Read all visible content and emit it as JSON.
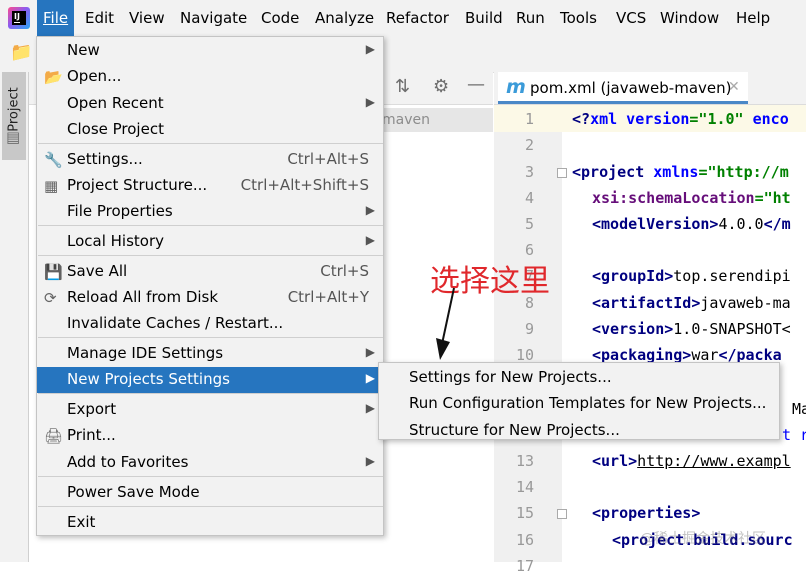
{
  "menubar": {
    "items": [
      {
        "label": "File"
      },
      {
        "label": "Edit"
      },
      {
        "label": "View"
      },
      {
        "label": "Navigate"
      },
      {
        "label": "Code"
      },
      {
        "label": "Analyze"
      },
      {
        "label": "Refactor"
      },
      {
        "label": "Build"
      },
      {
        "label": "Run"
      },
      {
        "label": "Tools"
      },
      {
        "label": "VCS"
      },
      {
        "label": "Window"
      },
      {
        "label": "Help"
      }
    ],
    "active_item": "File"
  },
  "project_panel": {
    "tab_label": "Project",
    "selected_row_text": "maven"
  },
  "editor": {
    "tab_title": "pom.xml (javaweb-maven)",
    "line_numbers": [
      "1",
      "2",
      "3",
      "4",
      "5",
      "6",
      "7",
      "8",
      "9",
      "10",
      "13",
      "14",
      "15",
      "16",
      "17"
    ],
    "lines": {
      "l1": {
        "p1": "<?",
        "p2": "xml version",
        "p3": "=\"1.0\"",
        "p4": " enco"
      },
      "l3": {
        "p1": "<project ",
        "p2": "xmlns",
        "p3": "=\"http://m"
      },
      "l4": {
        "p1": "xsi:schemaLocation",
        "p2": "=\"ht"
      },
      "l5": {
        "p1": "<modelVersion>",
        "p2": "4.0.0",
        "p3": "</m"
      },
      "l7": {
        "p1": "<groupId>",
        "p2": "top.serendipi"
      },
      "l8": {
        "p1": "<artifactId>",
        "p2": "javaweb-ma"
      },
      "l9": {
        "p1": "<version>",
        "p2": "1.0-SNAPSHOT<"
      },
      "l10": {
        "p1": "<packaging>",
        "p2": "war",
        "p3": "</packa"
      },
      "l13_frag1": "Ma",
      "l13_frag2": "t r",
      "l14": {
        "p1": "<url>",
        "p2": "http://www.exampl"
      },
      "l16": {
        "p1": "<properties>"
      },
      "l17": {
        "p1": "<project.build.sourc"
      }
    }
  },
  "file_menu": {
    "items": [
      {
        "label": "New",
        "shortcut": "",
        "has_submenu": true,
        "icon": ""
      },
      {
        "label": "Open...",
        "shortcut": "",
        "has_submenu": false,
        "icon": "folder-open-icon"
      },
      {
        "label": "Open Recent",
        "shortcut": "",
        "has_submenu": true,
        "icon": ""
      },
      {
        "label": "Close Project",
        "shortcut": "",
        "has_submenu": false,
        "icon": ""
      },
      {
        "label": "Settings...",
        "shortcut": "Ctrl+Alt+S",
        "has_submenu": false,
        "icon": "wrench-icon"
      },
      {
        "label": "Project Structure...",
        "shortcut": "Ctrl+Alt+Shift+S",
        "has_submenu": false,
        "icon": "project-structure-icon"
      },
      {
        "label": "File Properties",
        "shortcut": "",
        "has_submenu": true,
        "icon": ""
      },
      {
        "label": "Local History",
        "shortcut": "",
        "has_submenu": true,
        "icon": ""
      },
      {
        "label": "Save All",
        "shortcut": "Ctrl+S",
        "has_submenu": false,
        "icon": "save-icon"
      },
      {
        "label": "Reload All from Disk",
        "shortcut": "Ctrl+Alt+Y",
        "has_submenu": false,
        "icon": "reload-icon"
      },
      {
        "label": "Invalidate Caches / Restart...",
        "shortcut": "",
        "has_submenu": false,
        "icon": ""
      },
      {
        "label": "Manage IDE Settings",
        "shortcut": "",
        "has_submenu": true,
        "icon": ""
      },
      {
        "label": "New Projects Settings",
        "shortcut": "",
        "has_submenu": true,
        "icon": "",
        "selected": true
      },
      {
        "label": "Export",
        "shortcut": "",
        "has_submenu": true,
        "icon": ""
      },
      {
        "label": "Print...",
        "shortcut": "",
        "has_submenu": false,
        "icon": "print-icon"
      },
      {
        "label": "Add to Favorites",
        "shortcut": "",
        "has_submenu": true,
        "icon": ""
      },
      {
        "label": "Power Save Mode",
        "shortcut": "",
        "has_submenu": false,
        "icon": ""
      },
      {
        "label": "Exit",
        "shortcut": "",
        "has_submenu": false,
        "icon": ""
      }
    ]
  },
  "submenu": {
    "items": [
      {
        "label": "Settings for New Projects..."
      },
      {
        "label": "Run Configuration Templates for New Projects..."
      },
      {
        "label": "Structure for New Projects..."
      }
    ]
  },
  "annotation": {
    "text": "选择这里",
    "color": "#e0282c"
  },
  "watermark": "@稀土掘金技术社区",
  "colors": {
    "selection": "#2675bf",
    "menu_bg": "#f2f2f2",
    "tab_underline": "#4a88c7"
  }
}
